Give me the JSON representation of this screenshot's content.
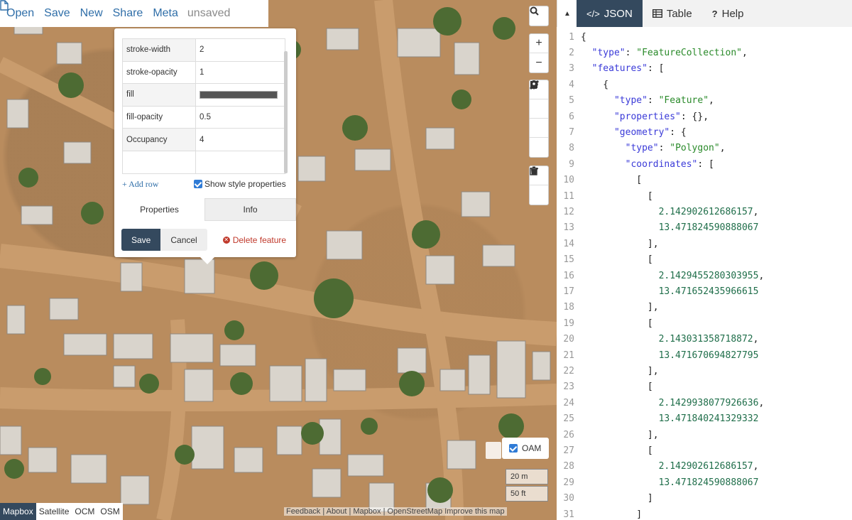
{
  "toolbar": {
    "open": "Open",
    "save": "Save",
    "new": "New",
    "share": "Share",
    "meta": "Meta",
    "file_status": "unsaved"
  },
  "popup": {
    "rows": [
      {
        "key": "stroke-width",
        "value": "2"
      },
      {
        "key": "stroke-opacity",
        "value": "1"
      },
      {
        "key": "fill",
        "value": "",
        "swatch": "#555555"
      },
      {
        "key": "fill-opacity",
        "value": "0.5"
      },
      {
        "key": "Occupancy",
        "value": "4"
      },
      {
        "key": "",
        "value": ""
      }
    ],
    "add_row": "Add row",
    "show_style": "Show style properties",
    "tab_properties": "Properties",
    "tab_info": "Info",
    "save": "Save",
    "cancel": "Cancel",
    "delete": "Delete feature"
  },
  "map": {
    "oam_label": "OAM",
    "scale_m": "20 m",
    "scale_ft": "50 ft",
    "basemaps": [
      "Mapbox",
      "Satellite",
      "OCM",
      "OSM"
    ],
    "active_basemap": "Mapbox",
    "attribution": "Feedback | About | Mapbox | OpenStreetMap Improve this map"
  },
  "panel": {
    "tabs": [
      {
        "label": "JSON",
        "icon": "code-icon"
      },
      {
        "label": "Table",
        "icon": "table-icon"
      },
      {
        "label": "Help",
        "icon": "question-icon"
      }
    ],
    "active_tab": "JSON"
  },
  "code_lines": [
    "{",
    "  \"type\": \"FeatureCollection\",",
    "  \"features\": [",
    "    {",
    "      \"type\": \"Feature\",",
    "      \"properties\": {},",
    "      \"geometry\": {",
    "        \"type\": \"Polygon\",",
    "        \"coordinates\": [",
    "          [",
    "            [",
    "              2.142902612686157,",
    "              13.471824590888067",
    "            ],",
    "            [",
    "              2.1429455280303955,",
    "              13.471652435966615",
    "            ],",
    "            [",
    "              2.143031358718872,",
    "              13.471670694827795",
    "            ],",
    "            [",
    "              2.1429938077926636,",
    "              13.471840241329332",
    "            ],",
    "            [",
    "              2.142902612686157,",
    "              13.471824590888067",
    "            ]",
    "          ]"
  ]
}
